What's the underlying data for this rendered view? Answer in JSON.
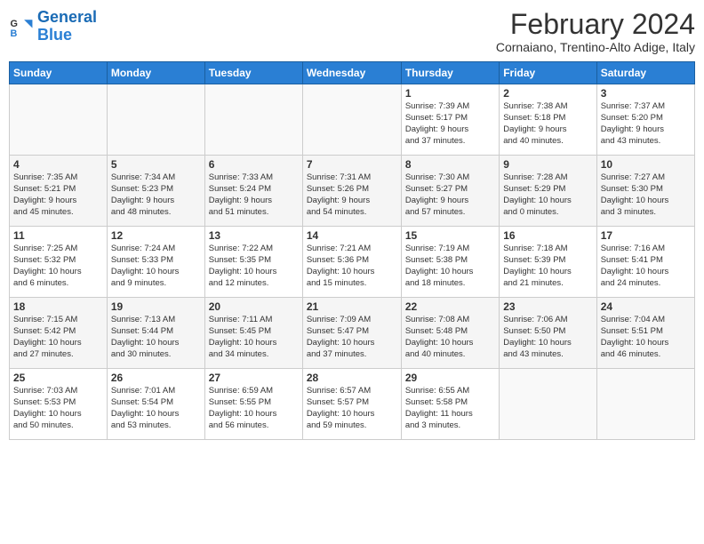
{
  "logo": {
    "line1": "General",
    "line2": "Blue"
  },
  "title": "February 2024",
  "location": "Cornaiano, Trentino-Alto Adige, Italy",
  "days_header": [
    "Sunday",
    "Monday",
    "Tuesday",
    "Wednesday",
    "Thursday",
    "Friday",
    "Saturday"
  ],
  "weeks": [
    [
      {
        "day": "",
        "info": ""
      },
      {
        "day": "",
        "info": ""
      },
      {
        "day": "",
        "info": ""
      },
      {
        "day": "",
        "info": ""
      },
      {
        "day": "1",
        "info": "Sunrise: 7:39 AM\nSunset: 5:17 PM\nDaylight: 9 hours\nand 37 minutes."
      },
      {
        "day": "2",
        "info": "Sunrise: 7:38 AM\nSunset: 5:18 PM\nDaylight: 9 hours\nand 40 minutes."
      },
      {
        "day": "3",
        "info": "Sunrise: 7:37 AM\nSunset: 5:20 PM\nDaylight: 9 hours\nand 43 minutes."
      }
    ],
    [
      {
        "day": "4",
        "info": "Sunrise: 7:35 AM\nSunset: 5:21 PM\nDaylight: 9 hours\nand 45 minutes."
      },
      {
        "day": "5",
        "info": "Sunrise: 7:34 AM\nSunset: 5:23 PM\nDaylight: 9 hours\nand 48 minutes."
      },
      {
        "day": "6",
        "info": "Sunrise: 7:33 AM\nSunset: 5:24 PM\nDaylight: 9 hours\nand 51 minutes."
      },
      {
        "day": "7",
        "info": "Sunrise: 7:31 AM\nSunset: 5:26 PM\nDaylight: 9 hours\nand 54 minutes."
      },
      {
        "day": "8",
        "info": "Sunrise: 7:30 AM\nSunset: 5:27 PM\nDaylight: 9 hours\nand 57 minutes."
      },
      {
        "day": "9",
        "info": "Sunrise: 7:28 AM\nSunset: 5:29 PM\nDaylight: 10 hours\nand 0 minutes."
      },
      {
        "day": "10",
        "info": "Sunrise: 7:27 AM\nSunset: 5:30 PM\nDaylight: 10 hours\nand 3 minutes."
      }
    ],
    [
      {
        "day": "11",
        "info": "Sunrise: 7:25 AM\nSunset: 5:32 PM\nDaylight: 10 hours\nand 6 minutes."
      },
      {
        "day": "12",
        "info": "Sunrise: 7:24 AM\nSunset: 5:33 PM\nDaylight: 10 hours\nand 9 minutes."
      },
      {
        "day": "13",
        "info": "Sunrise: 7:22 AM\nSunset: 5:35 PM\nDaylight: 10 hours\nand 12 minutes."
      },
      {
        "day": "14",
        "info": "Sunrise: 7:21 AM\nSunset: 5:36 PM\nDaylight: 10 hours\nand 15 minutes."
      },
      {
        "day": "15",
        "info": "Sunrise: 7:19 AM\nSunset: 5:38 PM\nDaylight: 10 hours\nand 18 minutes."
      },
      {
        "day": "16",
        "info": "Sunrise: 7:18 AM\nSunset: 5:39 PM\nDaylight: 10 hours\nand 21 minutes."
      },
      {
        "day": "17",
        "info": "Sunrise: 7:16 AM\nSunset: 5:41 PM\nDaylight: 10 hours\nand 24 minutes."
      }
    ],
    [
      {
        "day": "18",
        "info": "Sunrise: 7:15 AM\nSunset: 5:42 PM\nDaylight: 10 hours\nand 27 minutes."
      },
      {
        "day": "19",
        "info": "Sunrise: 7:13 AM\nSunset: 5:44 PM\nDaylight: 10 hours\nand 30 minutes."
      },
      {
        "day": "20",
        "info": "Sunrise: 7:11 AM\nSunset: 5:45 PM\nDaylight: 10 hours\nand 34 minutes."
      },
      {
        "day": "21",
        "info": "Sunrise: 7:09 AM\nSunset: 5:47 PM\nDaylight: 10 hours\nand 37 minutes."
      },
      {
        "day": "22",
        "info": "Sunrise: 7:08 AM\nSunset: 5:48 PM\nDaylight: 10 hours\nand 40 minutes."
      },
      {
        "day": "23",
        "info": "Sunrise: 7:06 AM\nSunset: 5:50 PM\nDaylight: 10 hours\nand 43 minutes."
      },
      {
        "day": "24",
        "info": "Sunrise: 7:04 AM\nSunset: 5:51 PM\nDaylight: 10 hours\nand 46 minutes."
      }
    ],
    [
      {
        "day": "25",
        "info": "Sunrise: 7:03 AM\nSunset: 5:53 PM\nDaylight: 10 hours\nand 50 minutes."
      },
      {
        "day": "26",
        "info": "Sunrise: 7:01 AM\nSunset: 5:54 PM\nDaylight: 10 hours\nand 53 minutes."
      },
      {
        "day": "27",
        "info": "Sunrise: 6:59 AM\nSunset: 5:55 PM\nDaylight: 10 hours\nand 56 minutes."
      },
      {
        "day": "28",
        "info": "Sunrise: 6:57 AM\nSunset: 5:57 PM\nDaylight: 10 hours\nand 59 minutes."
      },
      {
        "day": "29",
        "info": "Sunrise: 6:55 AM\nSunset: 5:58 PM\nDaylight: 11 hours\nand 3 minutes."
      },
      {
        "day": "",
        "info": ""
      },
      {
        "day": "",
        "info": ""
      }
    ]
  ]
}
